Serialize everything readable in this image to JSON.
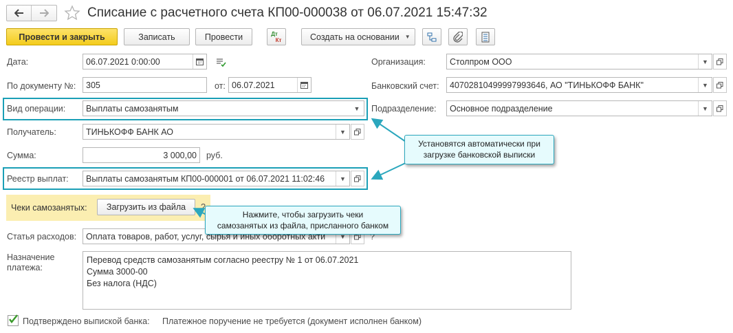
{
  "window": {
    "title": "Списание с расчетного счета КП00-000038 от 06.07.2021 15:47:32"
  },
  "toolbar": {
    "post_close_label": "Провести и закрыть",
    "save_label": "Записать",
    "post_label": "Провести",
    "dt_kt_label_dt": "Дт",
    "dt_kt_label_kt": "Кт",
    "create_based_label": "Создать на основании"
  },
  "form": {
    "date": {
      "label": "Дата:",
      "value": "06.07.2021  0:00:00"
    },
    "doc_number": {
      "label": "По документу №:",
      "value": "305"
    },
    "doc_date": {
      "label": "от:",
      "value": "06.07.2021"
    },
    "operation": {
      "label": "Вид операции:",
      "value": "Выплаты самозанятым"
    },
    "recipient": {
      "label": "Получатель:",
      "value": "ТИНЬКОФФ БАНК АО"
    },
    "amount": {
      "label": "Сумма:",
      "value": "3 000,00",
      "currency": "руб."
    },
    "registry": {
      "label": "Реестр выплат:",
      "value": "Выплаты самозанятым КП00-000001 от 06.07.2021 11:02:46"
    },
    "receipts": {
      "label": "Чеки самозанятых:",
      "button": "Загрузить из файла",
      "help": "?"
    },
    "expense": {
      "label": "Статья расходов:",
      "value": "Оплата товаров, работ, услуг, сырья и иных оборотных акти",
      "help": "?"
    },
    "purpose": {
      "label_line1": "Назначение",
      "label_line2": "платежа:",
      "line1": "Перевод средств самозанятым согласно реестру № 1 от 06.07.2021",
      "line2": "Сумма 3000-00",
      "line3": "Без налога (НДС)"
    },
    "organization": {
      "label": "Организация:",
      "value": "Столпром ООО"
    },
    "bank_account": {
      "label": "Банковский счет:",
      "value": "40702810499997993646, АО \"ТИНЬКОФФ БАНК\""
    },
    "division": {
      "label": "Подразделение:",
      "value": "Основное подразделение"
    },
    "confirmed": {
      "label": "Подтверждено выпиской банка:",
      "checked": true
    },
    "payment_order_text": "Платежное поручение не требуется (документ исполнен банком)"
  },
  "callouts": {
    "auto_line1": "Установятся автоматически при",
    "auto_line2": "загрузке банковской выписки",
    "load_line1": "Нажмите, чтобы загрузить чеки",
    "load_line2": "самозанятых из файла, присланного банком"
  },
  "colors": {
    "accent_yellow": "#f7d52c",
    "highlight_frame": "#1a9fb6",
    "callout_bg": "#e6fbfd",
    "receipts_band": "#fbeeb1",
    "checkbox_green": "#3a9a2a"
  }
}
